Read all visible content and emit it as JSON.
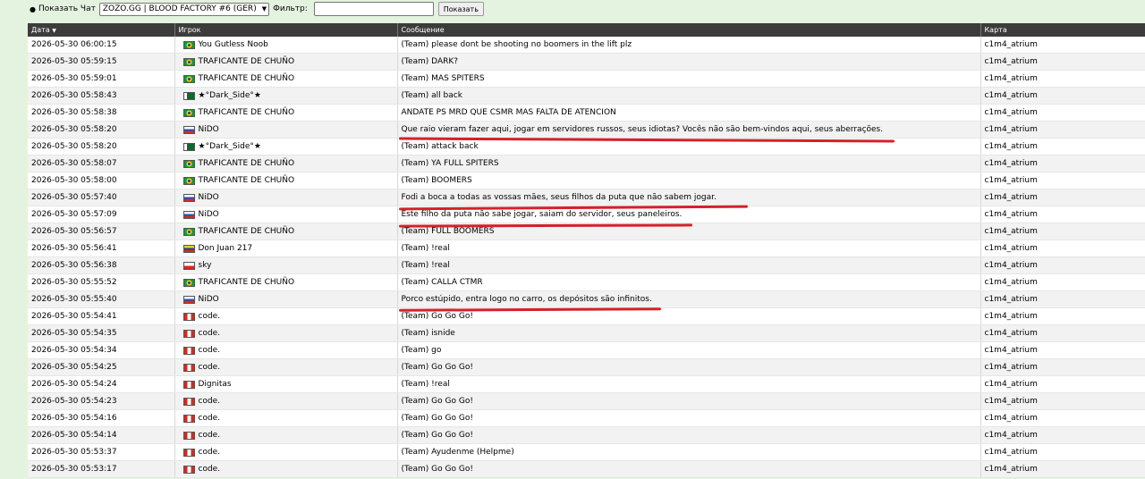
{
  "toolbar": {
    "bullet": "●",
    "show_chat_label": "Показать Чат",
    "server_selected": "ZOZO.GG | BLOOD FACTORY #6 (GER)",
    "filter_label": "Фильтр:",
    "filter_value": "",
    "show_button": "Показать"
  },
  "table": {
    "headers": {
      "date": "Дата",
      "date_sort": "▼",
      "player": "Игрок",
      "message": "Сообщение",
      "map": "Карта"
    },
    "rows": [
      {
        "date": "2026-05-30 06:00:15",
        "flag": "br",
        "player": "You Gutless Noob",
        "message": "(Team) please dont be shooting no boomers in the lift plz",
        "map": "c1m4_atrium"
      },
      {
        "date": "2026-05-30 05:59:15",
        "flag": "br",
        "player": "TRAFICANTE DE CHUÑO",
        "message": "(Team) DARK?",
        "map": "c1m4_atrium"
      },
      {
        "date": "2026-05-30 05:59:01",
        "flag": "br",
        "player": "TRAFICANTE DE CHUÑO",
        "message": "(Team) MAS SPITERS",
        "map": "c1m4_atrium"
      },
      {
        "date": "2026-05-30 05:58:43",
        "flag": "pk",
        "player": "★°Dark_Side°★",
        "message": "(Team) all back",
        "map": "c1m4_atrium"
      },
      {
        "date": "2026-05-30 05:58:38",
        "flag": "br",
        "player": "TRAFICANTE DE CHUÑO",
        "message": "ANDATE PS MRD QUE CSMR MAS FALTA DE ATENCION",
        "map": "c1m4_atrium"
      },
      {
        "date": "2026-05-30 05:58:20",
        "flag": "ru",
        "player": "NiDO",
        "message": "Que raio vieram fazer aqui, jogar em servidores russos, seus idiotas? Vocês não são bem-vindos aqui, seus aberrações.",
        "map": "c1m4_atrium"
      },
      {
        "date": "2026-05-30 05:58:20",
        "flag": "pk",
        "player": "★°Dark_Side°★",
        "message": "(Team) attack back",
        "map": "c1m4_atrium"
      },
      {
        "date": "2026-05-30 05:58:07",
        "flag": "br",
        "player": "TRAFICANTE DE CHUÑO",
        "message": "(Team) YA FULL SPITERS",
        "map": "c1m4_atrium"
      },
      {
        "date": "2026-05-30 05:58:00",
        "flag": "br",
        "player": "TRAFICANTE DE CHUÑO",
        "message": "(Team) BOOMERS",
        "map": "c1m4_atrium"
      },
      {
        "date": "2026-05-30 05:57:40",
        "flag": "ru",
        "player": "NiDO",
        "message": "Fodi a boca a todas as vossas mães, seus filhos da puta que não sabem jogar.",
        "map": "c1m4_atrium"
      },
      {
        "date": "2026-05-30 05:57:09",
        "flag": "ru",
        "player": "NiDO",
        "message": "Este filho da puta não sabe jogar, saiam do servidor, seus paneleiros.",
        "map": "c1m4_atrium"
      },
      {
        "date": "2026-05-30 05:56:57",
        "flag": "br",
        "player": "TRAFICANTE DE CHUÑO",
        "message": "(Team) FULL BOOMERS",
        "map": "c1m4_atrium"
      },
      {
        "date": "2026-05-30 05:56:41",
        "flag": "ve",
        "player": "Don Juan 217",
        "message": "(Team) !real",
        "map": "c1m4_atrium"
      },
      {
        "date": "2026-05-30 05:56:38",
        "flag": "cl",
        "player": "sky",
        "message": "(Team) !real",
        "map": "c1m4_atrium"
      },
      {
        "date": "2026-05-30 05:55:52",
        "flag": "br",
        "player": "TRAFICANTE DE CHUÑO",
        "message": "(Team) CALLA CTMR",
        "map": "c1m4_atrium"
      },
      {
        "date": "2026-05-30 05:55:40",
        "flag": "ru",
        "player": "NiDO",
        "message": "Porco estúpido, entra logo no carro, os depósitos são infinitos.",
        "map": "c1m4_atrium"
      },
      {
        "date": "2026-05-30 05:54:41",
        "flag": "pe",
        "player": "code.",
        "message": "(Team) Go Go Go!",
        "map": "c1m4_atrium"
      },
      {
        "date": "2026-05-30 05:54:35",
        "flag": "pe",
        "player": "code.",
        "message": "(Team) isnide",
        "map": "c1m4_atrium"
      },
      {
        "date": "2026-05-30 05:54:34",
        "flag": "pe",
        "player": "code.",
        "message": "(Team) go",
        "map": "c1m4_atrium"
      },
      {
        "date": "2026-05-30 05:54:25",
        "flag": "pe",
        "player": "code.",
        "message": "(Team) Go Go Go!",
        "map": "c1m4_atrium"
      },
      {
        "date": "2026-05-30 05:54:24",
        "flag": "pe",
        "player": "Dignitas",
        "message": "(Team) !real",
        "map": "c1m4_atrium"
      },
      {
        "date": "2026-05-30 05:54:23",
        "flag": "pe",
        "player": "code.",
        "message": "(Team) Go Go Go!",
        "map": "c1m4_atrium"
      },
      {
        "date": "2026-05-30 05:54:16",
        "flag": "pe",
        "player": "code.",
        "message": "(Team) Go Go Go!",
        "map": "c1m4_atrium"
      },
      {
        "date": "2026-05-30 05:54:14",
        "flag": "pe",
        "player": "code.",
        "message": "(Team) Go Go Go!",
        "map": "c1m4_atrium"
      },
      {
        "date": "2026-05-30 05:53:37",
        "flag": "pe",
        "player": "code.",
        "message": "(Team) Ayudenme (Helpme)",
        "map": "c1m4_atrium"
      },
      {
        "date": "2026-05-30 05:53:17",
        "flag": "pe",
        "player": "code.",
        "message": "(Team) Go Go Go!",
        "map": "c1m4_atrium"
      }
    ]
  }
}
